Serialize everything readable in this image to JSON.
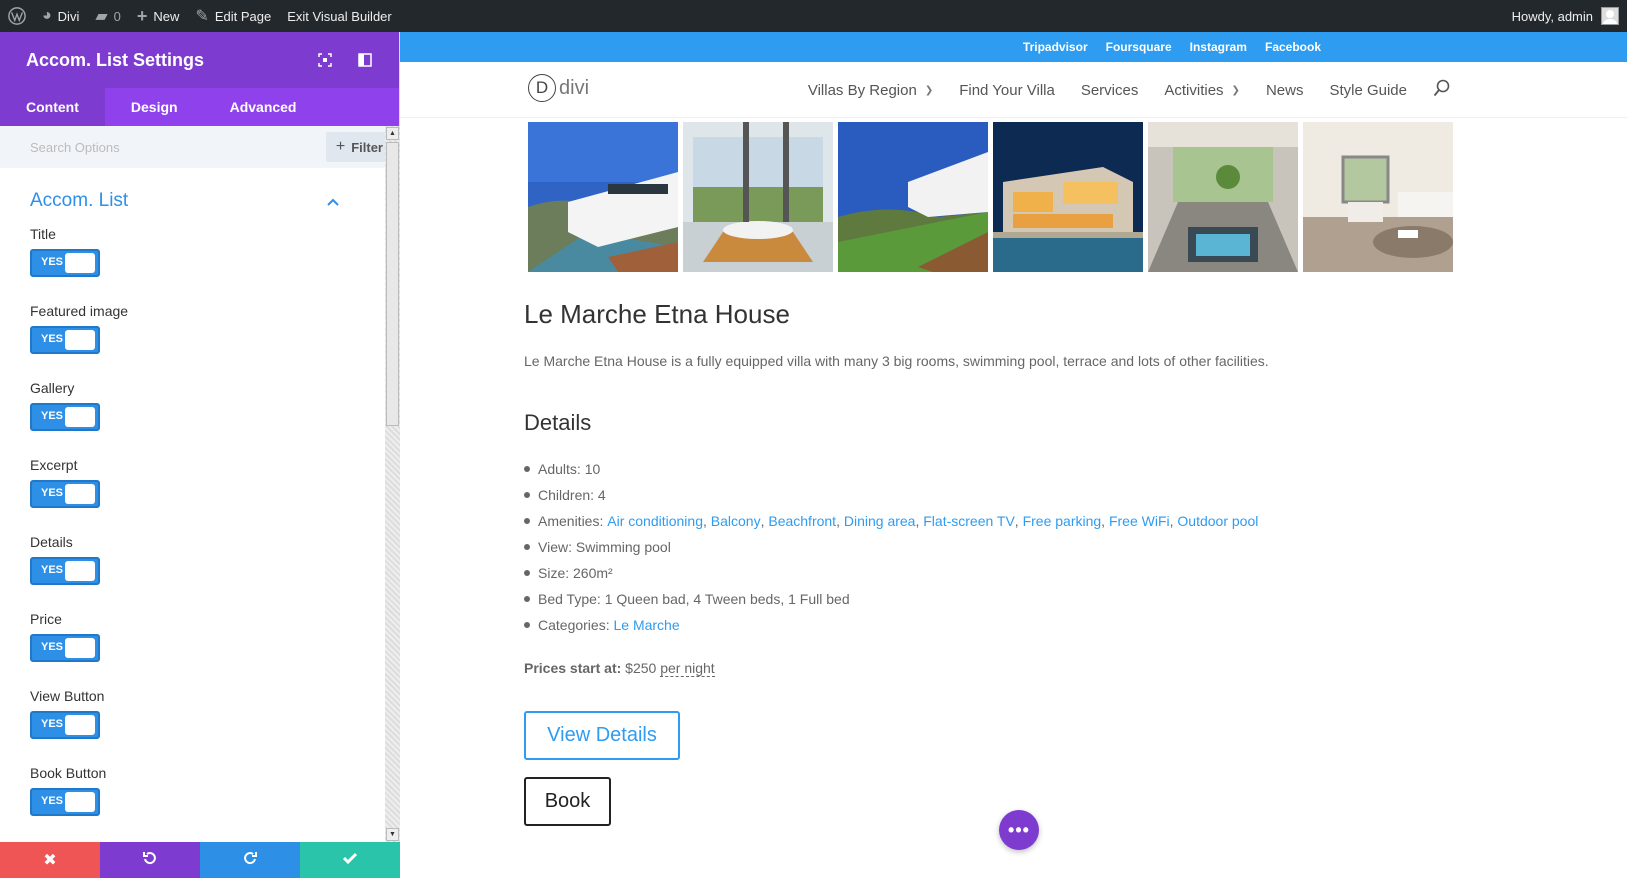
{
  "adminbar": {
    "site": "Divi",
    "comments": "0",
    "new": "New",
    "edit_page": "Edit Page",
    "exit_builder": "Exit Visual Builder",
    "howdy": "Howdy, admin"
  },
  "panel": {
    "title": "Accom. List Settings",
    "tabs": [
      {
        "label": "Content",
        "active": true
      },
      {
        "label": "Design",
        "active": false
      },
      {
        "label": "Advanced",
        "active": false
      }
    ],
    "search_placeholder": "Search Options",
    "filter_label": "Filter",
    "section_title": "Accom. List",
    "fields": [
      {
        "label": "Title",
        "value": "YES"
      },
      {
        "label": "Featured image",
        "value": "YES"
      },
      {
        "label": "Gallery",
        "value": "YES"
      },
      {
        "label": "Excerpt",
        "value": "YES"
      },
      {
        "label": "Details",
        "value": "YES"
      },
      {
        "label": "Price",
        "value": "YES"
      },
      {
        "label": "View Button",
        "value": "YES"
      },
      {
        "label": "Book Button",
        "value": "YES"
      }
    ],
    "footer_colors": {
      "cancel": "#ef5555",
      "undo": "#7e3bd0",
      "redo": "#2e8fe6",
      "save": "#29c4a9"
    }
  },
  "site": {
    "social_links": [
      "Tripadvisor",
      "Foursquare",
      "Instagram",
      "Facebook"
    ],
    "logo_text": "divi",
    "logo_letter": "D",
    "nav": [
      {
        "label": "Villas By Region",
        "has_submenu": true
      },
      {
        "label": "Find Your Villa",
        "has_submenu": false
      },
      {
        "label": "Services",
        "has_submenu": false
      },
      {
        "label": "Activities",
        "has_submenu": true
      },
      {
        "label": "News",
        "has_submenu": false
      },
      {
        "label": "Style Guide",
        "has_submenu": false
      }
    ],
    "accent_color": "#2e9cf0"
  },
  "accommodation": {
    "title": "Le Marche Etna House",
    "excerpt": "Le Marche Etna House is a fully equipped villa with many 3 big rooms, swimming pool, terrace and lots of other facilities.",
    "details_title": "Details",
    "details": {
      "adults_label": "Adults:",
      "adults": "10",
      "children_label": "Children:",
      "children": "4",
      "amenities_label": "Amenities:",
      "amenities": [
        "Air conditioning",
        "Balcony",
        "Beachfront",
        "Dining area",
        "Flat-screen TV",
        "Free parking",
        "Free WiFi",
        "Outdoor pool"
      ],
      "view_label": "View:",
      "view": "Swimming pool",
      "size_label": "Size:",
      "size": "260m²",
      "bed_label": "Bed Type:",
      "bed": "1 Queen bad, 4 Tween beds, 1 Full bed",
      "categories_label": "Categories:",
      "categories": "Le Marche"
    },
    "price_label": "Prices start at:",
    "price": "$250",
    "price_unit": "per night",
    "view_button": "View Details",
    "book_button": "Book"
  }
}
